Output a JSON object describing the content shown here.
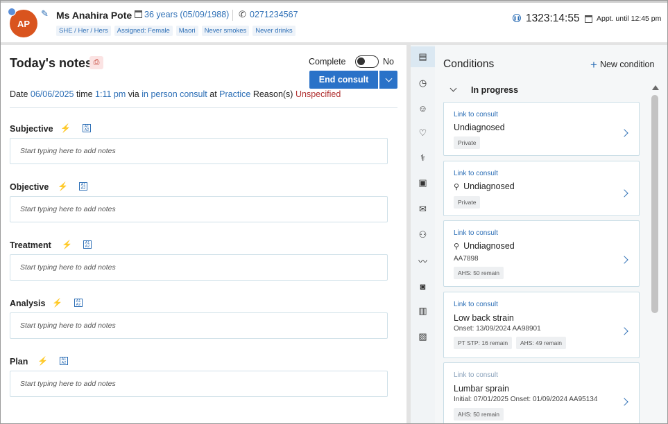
{
  "patient": {
    "initials": "AP",
    "name": "Ms Anahira Pote",
    "age_dob": "36 years (05/09/1988)",
    "phone": "0271234567",
    "tags": [
      "SHE / Her / Hers",
      "Assigned: Female",
      "Maori",
      "Never smokes",
      "Never drinks"
    ]
  },
  "session": {
    "timer": "1323:14:55",
    "appointment": "Appt. until 12:45 pm"
  },
  "notes": {
    "title": "Today's notes",
    "complete_label": "Complete",
    "complete_state": "No",
    "end_consult_label": "End consult",
    "meta": {
      "date_label": "Date",
      "date": "06/06/2025",
      "time_label": "time",
      "time": "1:11 pm",
      "via_label": "via",
      "via": "in person consult",
      "at_label": "at",
      "location": "Practice",
      "reasons_label": "Reason(s)",
      "reasons": "Unspecified"
    },
    "sections": [
      {
        "label": "Subjective",
        "placeholder": "Start typing here to add notes"
      },
      {
        "label": "Objective",
        "placeholder": "Start typing here to add notes"
      },
      {
        "label": "Treatment",
        "placeholder": "Start typing here to add notes"
      },
      {
        "label": "Analysis",
        "placeholder": "Start typing here to add notes"
      },
      {
        "label": "Plan",
        "placeholder": "Start typing here to add notes"
      }
    ]
  },
  "rail": {
    "icons": [
      "notes-icon",
      "clock-icon",
      "face-icon",
      "heart-pulse-icon",
      "pill-icon",
      "consult-icon",
      "mail-icon",
      "family-icon",
      "chart-icon",
      "camera-icon",
      "clipboard-icon",
      "image-icon"
    ]
  },
  "conditions": {
    "title": "Conditions",
    "new_label": "New condition",
    "group_label": "In progress",
    "cards": [
      {
        "link": "Link to consult",
        "name": "Undiagnosed",
        "badges": [
          "Private"
        ]
      },
      {
        "link": "Link to consult",
        "name": "Undiagnosed",
        "badges": [
          "Private"
        ]
      },
      {
        "link": "Link to consult",
        "name": "Undiagnosed",
        "sub": "AA7898",
        "badges": [
          "AHS: 50 remain"
        ]
      },
      {
        "link": "Link to consult",
        "name": "Low back strain",
        "sub": "Onset: 13/09/2024   AA98901",
        "badges": [
          "PT STP: 16 remain",
          "AHS: 49 remain"
        ]
      },
      {
        "link": "Link to consult",
        "name": "Lumbar sprain",
        "sub": "Initial: 07/01/2025   Onset: 01/09/2024   AA95134",
        "badges": [
          "AHS: 50 remain"
        ]
      }
    ]
  }
}
